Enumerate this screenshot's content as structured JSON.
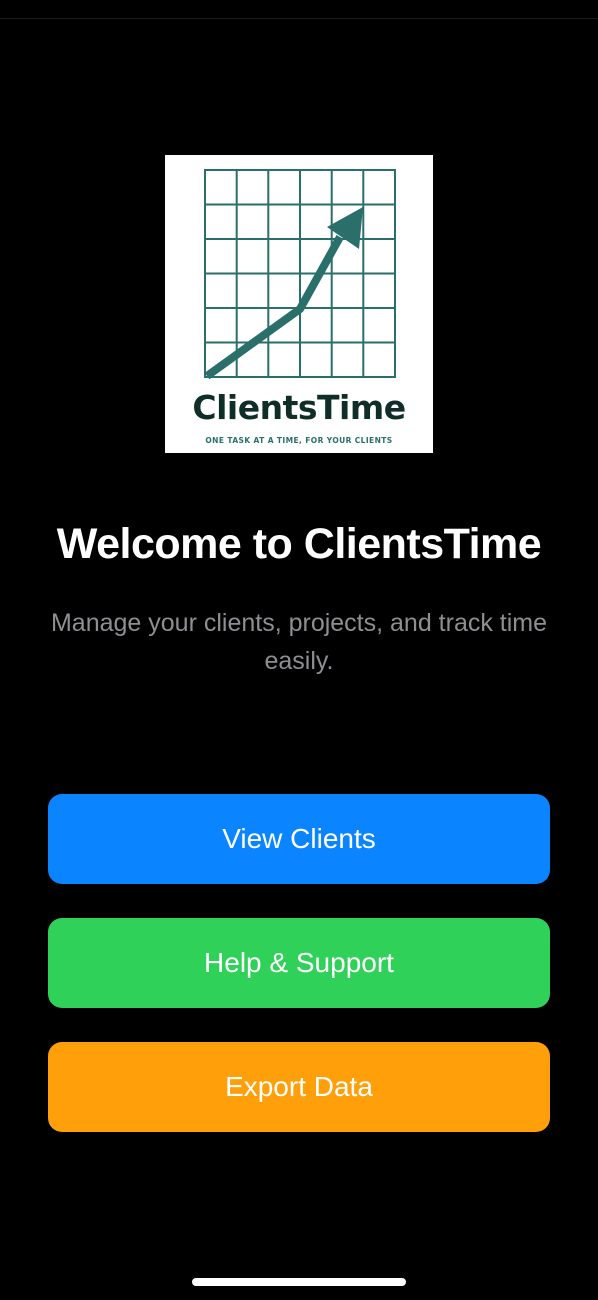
{
  "logo": {
    "wordmark": "ClientsTime",
    "tagline": "ONE TASK AT A TIME, FOR YOUR CLIENTS",
    "grid_color": "#2a6f6a",
    "arrow_color": "#2a6f6a",
    "wordmark_color": "#0f2e28"
  },
  "welcome": {
    "title": "Welcome to ClientsTime",
    "subtitle": "Manage your clients, projects, and track time easily."
  },
  "actions": {
    "view_clients": {
      "label": "View Clients",
      "color": "#0a84ff"
    },
    "help_support": {
      "label": "Help & Support",
      "color": "#30d158"
    },
    "export_data": {
      "label": "Export Data",
      "color": "#ff9f0a"
    }
  }
}
